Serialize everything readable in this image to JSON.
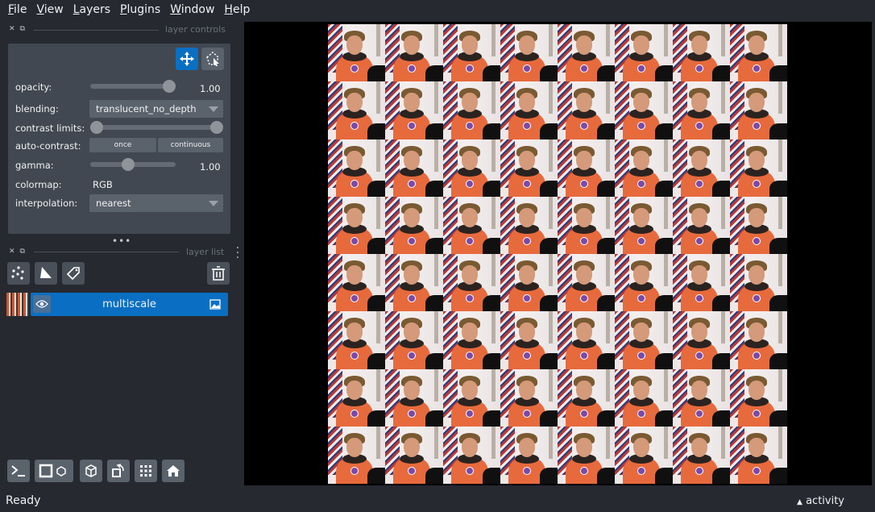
{
  "menu": {
    "items": [
      {
        "label": "File",
        "key": "F",
        "rest": "ile"
      },
      {
        "label": "View",
        "key": "V",
        "rest": "iew"
      },
      {
        "label": "Layers",
        "key": "L",
        "rest": "ayers"
      },
      {
        "label": "Plugins",
        "key": "P",
        "rest": "lugins"
      },
      {
        "label": "Window",
        "key": "W",
        "rest": "indow"
      },
      {
        "label": "Help",
        "key": "H",
        "rest": "elp"
      }
    ]
  },
  "layer_controls": {
    "title": "layer controls",
    "opacity_label": "opacity:",
    "opacity_value": "1.00",
    "opacity_fraction": 1.0,
    "blending_label": "blending:",
    "blending_value": "translucent_no_depth",
    "contrast_label": "contrast limits:",
    "contrast_range": [
      0.0,
      1.0
    ],
    "auto_contrast_label": "auto-contrast:",
    "once_label": "once",
    "continuous_label": "continuous",
    "gamma_label": "gamma:",
    "gamma_value": "1.00",
    "gamma_fraction": 0.5,
    "colormap_label": "colormap:",
    "colormap_value": "RGB",
    "interpolation_label": "interpolation:",
    "interpolation_value": "nearest"
  },
  "layer_list": {
    "title": "layer list",
    "layers": [
      {
        "name": "multiscale",
        "visible": true,
        "type_icon": "image-icon"
      }
    ]
  },
  "canvas": {
    "tile_rows": 8,
    "tile_cols": 8,
    "background": "#000000"
  },
  "status": {
    "ready": "Ready",
    "activity": "activity"
  },
  "colors": {
    "accent": "#0a6fc2",
    "background": "#262930",
    "panel": "#414851"
  }
}
